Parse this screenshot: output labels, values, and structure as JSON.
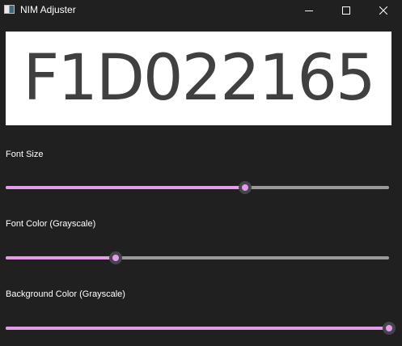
{
  "window": {
    "title": "NIM Adjuster",
    "icon": "app-window-icon",
    "controls": [
      "minimize-icon",
      "maximize-icon",
      "close-icon"
    ]
  },
  "preview": {
    "text": "F1D022165"
  },
  "controls": {
    "font_size": {
      "label": "Font Size",
      "value_fraction": 0.625
    },
    "font_color": {
      "label": "Font Color (Grayscale)",
      "value_fraction": 0.286
    },
    "background_color": {
      "label": "Background Color (Grayscale)",
      "value_fraction": 1.0
    }
  },
  "colors": {
    "accent": "#e29ce8",
    "track": "#9a9a9a",
    "background": "#202020",
    "preview_background": "#ffffff",
    "preview_text": "#404040"
  }
}
